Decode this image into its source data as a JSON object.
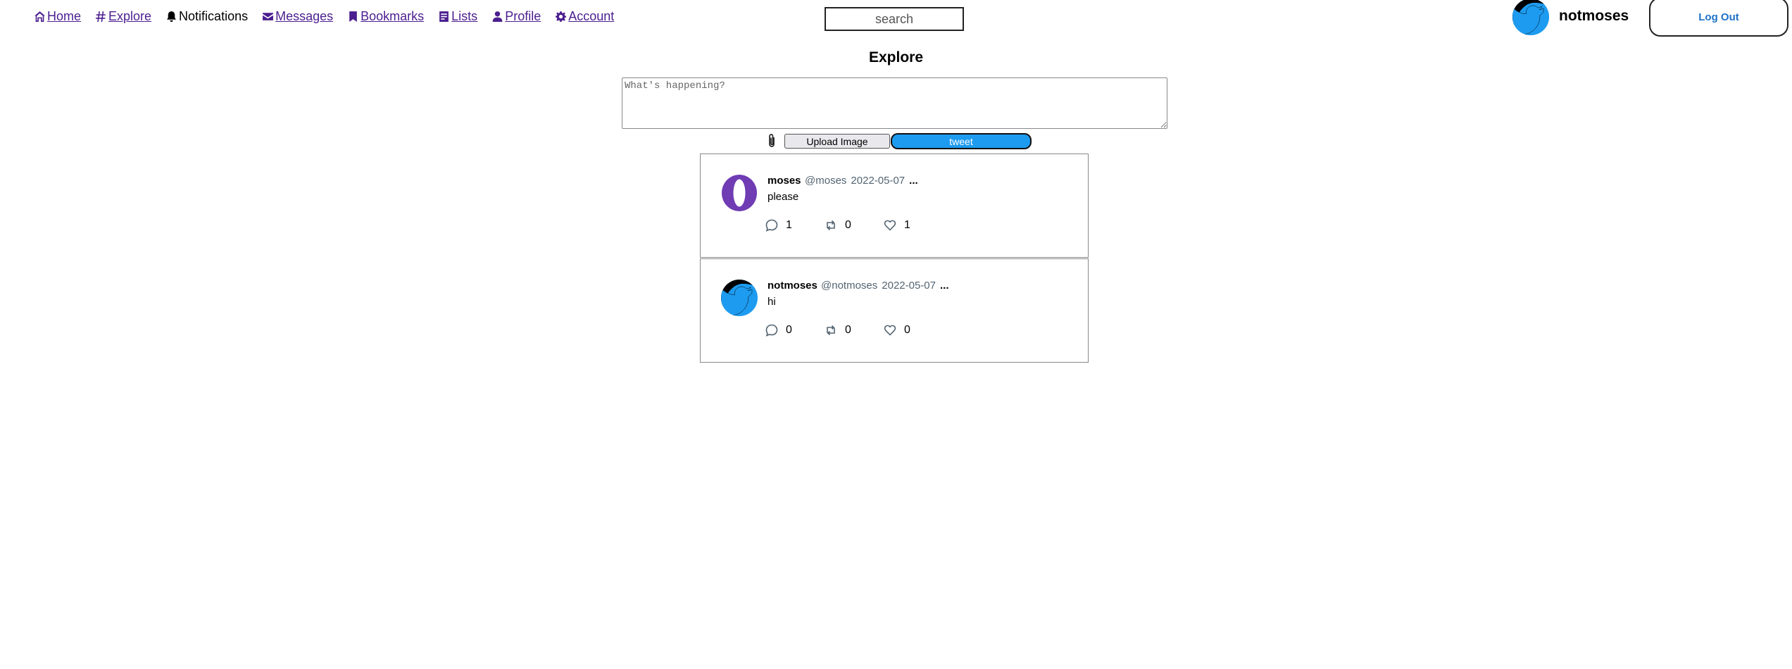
{
  "nav": {
    "home": "Home",
    "explore": "Explore",
    "notifications": "Notifications",
    "messages": "Messages",
    "bookmarks": "Bookmarks",
    "lists": "Lists",
    "profile": "Profile",
    "account": "Account"
  },
  "search": {
    "placeholder": "search"
  },
  "user": {
    "name": "notmoses"
  },
  "logout_label": "Log Out",
  "page_title": "Explore",
  "composer": {
    "placeholder": "What's happening?",
    "upload_label": "Upload Image",
    "tweet_label": "tweet"
  },
  "tweets": [
    {
      "name": "moses",
      "handle": "@moses",
      "date": "2022-05-07",
      "more": "...",
      "text": "please",
      "replies": "1",
      "retweets": "0",
      "likes": "1"
    },
    {
      "name": "notmoses",
      "handle": "@notmoses",
      "date": "2022-05-07",
      "more": "...",
      "text": "hi",
      "replies": "0",
      "retweets": "0",
      "likes": "0"
    }
  ],
  "colors": {
    "link": "#4b1e8f",
    "accent": "#1d9bf0",
    "logout_text": "#1d72c8",
    "meta_text": "#536471",
    "opera_purple": "#6f3cb4"
  },
  "icons": [
    "home-icon",
    "hashtag-icon",
    "bell-icon",
    "envelope-icon",
    "bookmark-icon",
    "list-icon",
    "person-icon",
    "gear-icon",
    "paperclip-icon",
    "comment-icon",
    "retweet-icon",
    "heart-icon"
  ]
}
